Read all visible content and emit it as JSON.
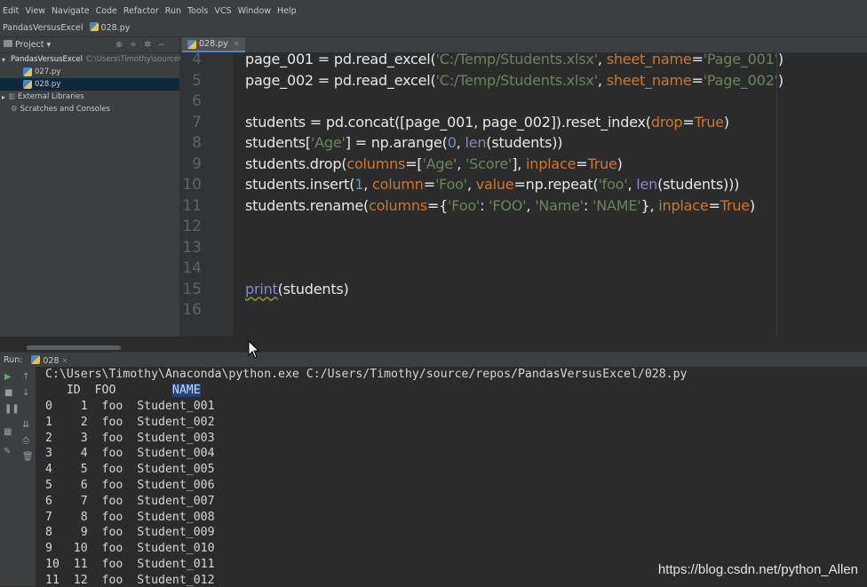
{
  "menu": [
    "Edit",
    "View",
    "Navigate",
    "Code",
    "Refactor",
    "Run",
    "Tools",
    "VCS",
    "Window",
    "Help"
  ],
  "nav": {
    "project_name": "PandasVersusExcel",
    "file": "028.py"
  },
  "project_panel": {
    "header": "Project",
    "root": "PandasVersusExcel",
    "root_path": "C:\\Users\\Timothy\\source\\",
    "files": [
      "027.py",
      "028.py"
    ],
    "external": "External Libraries",
    "scratches": "Scratches and Consoles"
  },
  "editor": {
    "tab": "028.py",
    "line_numbers": [
      "4",
      "5",
      "6",
      "7",
      "8",
      "9",
      "10",
      "11",
      "12",
      "13",
      "14",
      "15",
      "16"
    ],
    "lines": [
      [
        [
          "t",
          "page_001 = pd.read_excel("
        ],
        [
          "s",
          "'C:/Temp/Students.xlsx'"
        ],
        [
          "t",
          ", "
        ],
        [
          "k",
          "sheet_name"
        ],
        [
          "t",
          "="
        ],
        [
          "s",
          "'Page_001'"
        ],
        [
          "t",
          ")"
        ]
      ],
      [
        [
          "t",
          "page_002 = pd.read_excel("
        ],
        [
          "s",
          "'C:/Temp/Students.xlsx'"
        ],
        [
          "t",
          ", "
        ],
        [
          "k",
          "sheet_name"
        ],
        [
          "t",
          "="
        ],
        [
          "s",
          "'Page_002'"
        ],
        [
          "t",
          ")"
        ]
      ],
      [],
      [
        [
          "t",
          "students = pd.concat([page_001, page_002]).reset_index("
        ],
        [
          "k",
          "drop"
        ],
        [
          "t",
          "="
        ],
        [
          "k",
          "True"
        ],
        [
          "t",
          ")"
        ]
      ],
      [
        [
          "t",
          "students["
        ],
        [
          "s",
          "'Age'"
        ],
        [
          "t",
          "] = np.arange("
        ],
        [
          "n",
          "0"
        ],
        [
          "t",
          ", "
        ],
        [
          "b",
          "len"
        ],
        [
          "t",
          "(students))"
        ]
      ],
      [
        [
          "t",
          "students.drop("
        ],
        [
          "k",
          "columns"
        ],
        [
          "t",
          "=["
        ],
        [
          "s",
          "'Age'"
        ],
        [
          "t",
          ", "
        ],
        [
          "s",
          "'Score'"
        ],
        [
          "t",
          "], "
        ],
        [
          "k",
          "inplace"
        ],
        [
          "t",
          "="
        ],
        [
          "k",
          "True"
        ],
        [
          "t",
          ")"
        ]
      ],
      [
        [
          "t",
          "students.insert("
        ],
        [
          "n",
          "1"
        ],
        [
          "t",
          ", "
        ],
        [
          "k",
          "column"
        ],
        [
          "t",
          "="
        ],
        [
          "s",
          "'Foo'"
        ],
        [
          "t",
          ", "
        ],
        [
          "k",
          "value"
        ],
        [
          "t",
          "=np.repeat("
        ],
        [
          "s",
          "'foo'"
        ],
        [
          "t",
          ", "
        ],
        [
          "b",
          "len"
        ],
        [
          "t",
          "(students)))"
        ]
      ],
      [
        [
          "t",
          "students.rename("
        ],
        [
          "k",
          "columns"
        ],
        [
          "t",
          "={"
        ],
        [
          "s",
          "'Foo'"
        ],
        [
          "t",
          ": "
        ],
        [
          "s",
          "'FOO'"
        ],
        [
          "t",
          ", "
        ],
        [
          "s",
          "'Name'"
        ],
        [
          "t",
          ": "
        ],
        [
          "s",
          "'NAME'"
        ],
        [
          "t",
          "}, "
        ],
        [
          "k",
          "inplace"
        ],
        [
          "t",
          "="
        ],
        [
          "k",
          "True"
        ],
        [
          "t",
          ")"
        ]
      ],
      [],
      [],
      [],
      [
        [
          "p",
          "print"
        ],
        [
          "t",
          "(students)"
        ]
      ],
      []
    ]
  },
  "run": {
    "label": "Run:",
    "config": "028",
    "command": "C:\\Users\\Timothy\\Anaconda\\python.exe C:/Users/Timothy/source/repos/PandasVersusExcel/028.py",
    "header_pre": "   ID  FOO        ",
    "header_name": "NAME",
    "rows": [
      "0    1  foo  Student_001",
      "1    2  foo  Student_002",
      "2    3  foo  Student_003",
      "3    4  foo  Student_004",
      "4    5  foo  Student_005",
      "5    6  foo  Student_006",
      "6    7  foo  Student_007",
      "7    8  foo  Student_008",
      "8    9  foo  Student_009",
      "9   10  foo  Student_010",
      "10  11  foo  Student_011",
      "11  12  foo  Student_012"
    ]
  },
  "watermark": "https://blog.csdn.net/python_Allen",
  "icons": {
    "run": "play-icon",
    "stop": "stop-icon",
    "pause": "pause-icon",
    "up": "arrow-up-icon",
    "down": "arrow-down-icon"
  }
}
